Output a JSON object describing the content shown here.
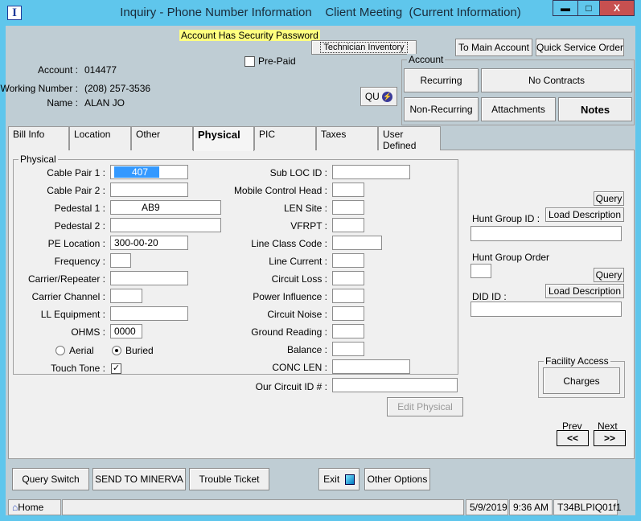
{
  "window": {
    "title": "Inquiry - Phone Number Information    Client Meeting  (Current Information)",
    "app_icon": "I",
    "minimize": "▬",
    "maximize": "□",
    "close": "X"
  },
  "header": {
    "security_notice": "Account Has Security Password",
    "technician_inventory": "Technician Inventory",
    "to_main_account": "To Main Account",
    "quick_service_order": "Quick Service Order",
    "prepaid_label": "Pre-Paid",
    "prepaid_checked": false,
    "account_label": "Account :",
    "account_value": "014477",
    "working_label": "Working Number :",
    "working_value": "(208) 257-3536",
    "name_label": "Name :",
    "name_value": "ALAN JO",
    "qu_button": "QU"
  },
  "account_group": {
    "title": "Account",
    "recurring": "Recurring",
    "no_contracts": "No Contracts",
    "non_recurring": "Non-Recurring",
    "attachments": "Attachments",
    "notes": "Notes"
  },
  "tabs": [
    {
      "label": "Bill Info"
    },
    {
      "label": "Location"
    },
    {
      "label": "Other"
    },
    {
      "label": "Physical",
      "active": true
    },
    {
      "label": "PIC"
    },
    {
      "label": "Taxes"
    },
    {
      "label": "User Defined"
    }
  ],
  "physical": {
    "title": "Physical",
    "left_fields": [
      {
        "label": "Cable Pair 1 :",
        "value": "407"
      },
      {
        "label": "Cable Pair 2 :",
        "value": ""
      },
      {
        "label": "Pedestal 1 :",
        "value": "AB9"
      },
      {
        "label": "Pedestal 2 :",
        "value": ""
      },
      {
        "label": "PE Location :",
        "value": "300-00-20"
      },
      {
        "label": "Frequency :",
        "value": ""
      },
      {
        "label": "Carrier/Repeater :",
        "value": ""
      },
      {
        "label": "Carrier Channel :",
        "value": ""
      },
      {
        "label": "LL Equipment :",
        "value": ""
      },
      {
        "label": "OHMS :",
        "value": "0000"
      }
    ],
    "aerial": "Aerial",
    "buried": "Buried",
    "selected_type": "Buried",
    "touch_tone_label": "Touch Tone :",
    "touch_tone": true,
    "right_fields": [
      {
        "label": "Sub LOC ID :",
        "value": ""
      },
      {
        "label": "Mobile Control Head :",
        "value": ""
      },
      {
        "label": "LEN Site :",
        "value": ""
      },
      {
        "label": "VFRPT :",
        "value": ""
      },
      {
        "label": "Line Class Code :",
        "value": ""
      },
      {
        "label": "Line Current :",
        "value": ""
      },
      {
        "label": "Circuit Loss :",
        "value": ""
      },
      {
        "label": "Power Influence :",
        "value": ""
      },
      {
        "label": "Circuit Noise :",
        "value": ""
      },
      {
        "label": "Ground Reading :",
        "value": ""
      },
      {
        "label": "Balance :",
        "value": ""
      },
      {
        "label": "CONC LEN :",
        "value": ""
      }
    ],
    "circuit_label": "Our Circuit ID # :",
    "circuit_value": "",
    "edit_button": "Edit Physical"
  },
  "side": {
    "query": "Query",
    "load_description": "Load Description",
    "hunt_group_id_label": "Hunt Group ID :",
    "hunt_group_id": "",
    "hunt_group_order_label": "Hunt Group Order",
    "hunt_group_order": "",
    "did_label": "DID ID :",
    "did": "",
    "facility_title": "Facility Access",
    "charges": "Charges",
    "prev": "Prev",
    "next": "Next",
    "prev_btn": "<<",
    "next_btn": ">>"
  },
  "footer": {
    "query_switch": "Query Switch",
    "send_minerva": "SEND TO MINERVA",
    "trouble_ticket": "Trouble Ticket",
    "exit": "Exit",
    "other_options": "Other Options"
  },
  "status": {
    "home": "Home",
    "message": "",
    "date": "5/9/2019",
    "time": "9:36 AM",
    "code": "T34BLPIQ01f1"
  },
  "colors": {
    "titlebar": "#5fc6ec",
    "body": "#bfcdd4",
    "security": "#ffff80",
    "close": "#c75050"
  }
}
